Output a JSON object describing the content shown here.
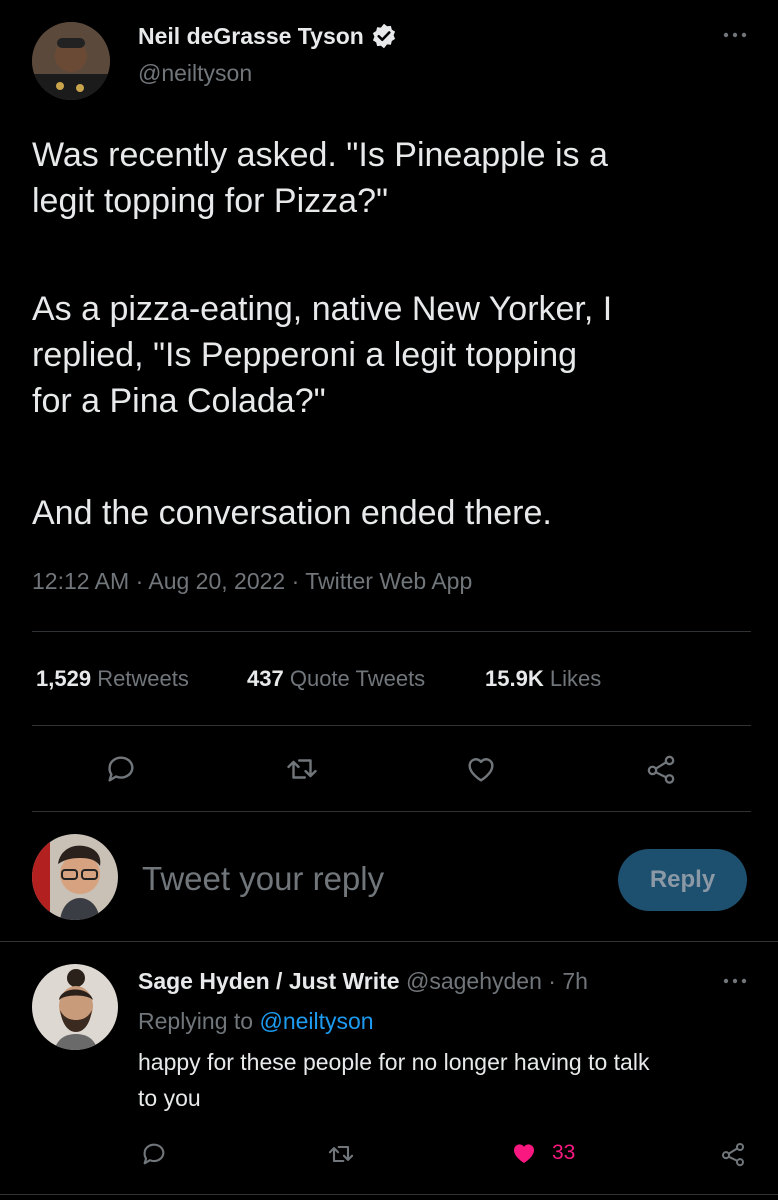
{
  "tweet": {
    "author_name": "Neil deGrasse Tyson",
    "author_handle": "@neiltyson",
    "paragraphs": [
      "Was recently asked. \"Is Pineapple is a\nlegit topping for Pizza?\"",
      "As a pizza-eating, native New Yorker, I\nreplied, \"Is Pepperoni a legit topping\nfor a Pina Colada?\"",
      "And the conversation ended there."
    ],
    "meta": "12:12 AM · Aug 20, 2022 · Twitter Web App",
    "stats": {
      "retweets_count": "1,529",
      "retweets_label": "Retweets",
      "quotes_count": "437",
      "quotes_label": "Quote Tweets",
      "likes_count": "15.9K",
      "likes_label": "Likes"
    }
  },
  "composer": {
    "placeholder": "Tweet your reply",
    "button_label": "Reply"
  },
  "reply": {
    "author_name": "Sage Hyden / Just Write",
    "author_handle": "@sagehyden",
    "time": "· 7h",
    "replying_prefix": "Replying to",
    "replying_handle": "@neiltyson",
    "text": "happy for these people for no longer having to talk\nto you",
    "like_count": "33"
  },
  "colors": {
    "background": "#000000",
    "text": "#e7e9ea",
    "muted": "#71767b",
    "link": "#1d9bf0",
    "like": "#f91880",
    "reply_button": "#1d4f6e"
  },
  "icons": [
    "verified-badge-icon",
    "more-icon",
    "reply-icon",
    "retweet-icon",
    "like-icon",
    "share-icon"
  ]
}
